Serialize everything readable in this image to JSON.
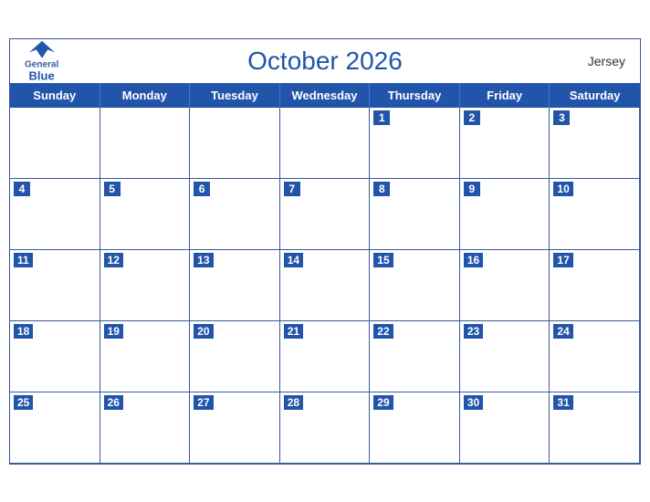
{
  "header": {
    "title": "October 2026",
    "country": "Jersey",
    "logo": {
      "general": "General",
      "blue": "Blue"
    }
  },
  "dayHeaders": [
    "Sunday",
    "Monday",
    "Tuesday",
    "Wednesday",
    "Thursday",
    "Friday",
    "Saturday"
  ],
  "weeks": [
    [
      null,
      null,
      null,
      null,
      1,
      2,
      3
    ],
    [
      4,
      5,
      6,
      7,
      8,
      9,
      10
    ],
    [
      11,
      12,
      13,
      14,
      15,
      16,
      17
    ],
    [
      18,
      19,
      20,
      21,
      22,
      23,
      24
    ],
    [
      25,
      26,
      27,
      28,
      29,
      30,
      31
    ]
  ]
}
